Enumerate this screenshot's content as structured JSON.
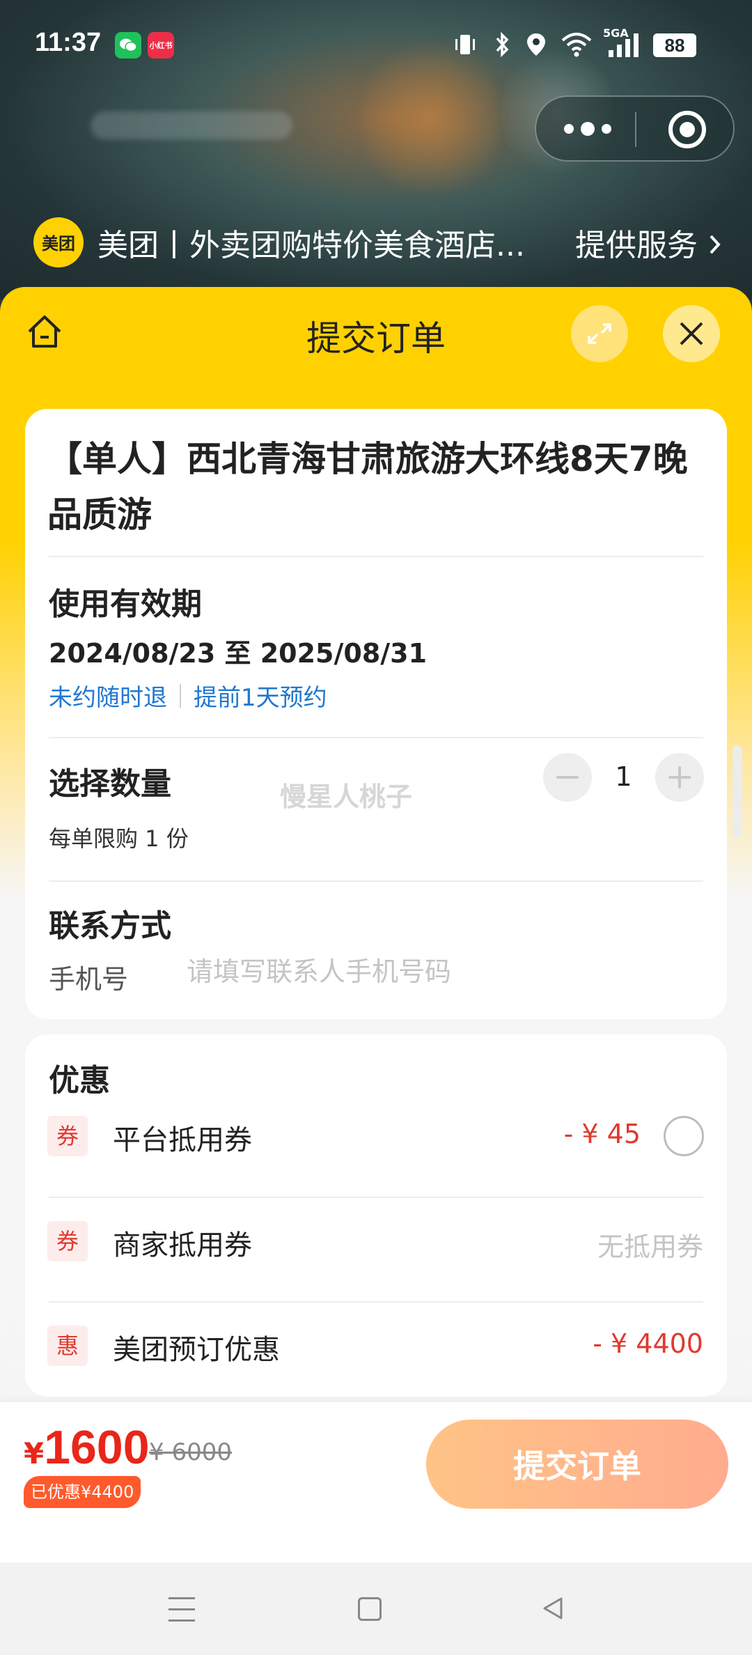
{
  "status_bar": {
    "time": "11:37",
    "network": "5GA",
    "battery": "88",
    "icons": [
      "wechat-icon",
      "xiaohongshu-icon",
      "vibrate-icon",
      "bluetooth-icon",
      "location-icon",
      "wifi-icon",
      "signal-icon"
    ],
    "redbook_label": "小红书"
  },
  "mini_program": {
    "logo_text": "美团",
    "name": "美团丨外卖团购特价美食酒店...",
    "service_label": "提供服务",
    "service_icon": "chevron-right-icon"
  },
  "sheet": {
    "title": "提交订单",
    "home_icon": "home-icon",
    "expand_icon": "expand-icon",
    "close_icon": "close-icon",
    "accent_color": "#ffd100"
  },
  "product": {
    "title": "【单人】西北青海甘肃旅游大环线8天7晚品质游"
  },
  "validity": {
    "heading": "使用有效期",
    "date_range": "2024/08/23 至 2025/08/31",
    "refund_policy": "未约随时退",
    "booking_policy": "提前1天预约"
  },
  "quantity": {
    "heading": "选择数量",
    "value": "1",
    "limit_text": "每单限购 1 份",
    "watermark": "慢星人桃子"
  },
  "contact": {
    "heading": "联系方式",
    "phone_label": "手机号",
    "phone_value": "",
    "phone_placeholder": "请填写联系人手机号码"
  },
  "discounts": {
    "heading": "优惠",
    "items": [
      {
        "badge": "券",
        "name": "平台抵用券",
        "amount": "- ¥ 45",
        "selectable": true
      },
      {
        "badge": "券",
        "name": "商家抵用券",
        "amount": "无抵用券",
        "selectable": false
      },
      {
        "badge": "惠",
        "name": "美团预订优惠",
        "amount": "- ¥ 4400",
        "selectable": false
      }
    ]
  },
  "checkout": {
    "currency": "¥",
    "price": "1600",
    "original_price": "¥ 6000",
    "saved_text": "已优惠¥4400",
    "submit_label": "提交订单",
    "price_color": "#e8261a"
  },
  "nav_bar": {
    "icons": [
      "menu-icon",
      "home-square-icon",
      "back-triangle-icon"
    ]
  }
}
